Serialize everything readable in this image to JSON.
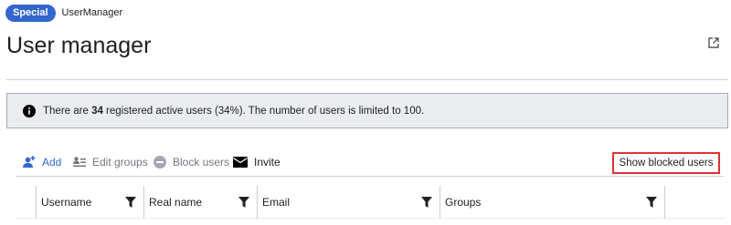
{
  "breadcrumb": {
    "badge": "Special",
    "page": "UserManager"
  },
  "page_title": "User manager",
  "notice": {
    "prefix": "There are ",
    "count": "34",
    "suffix": " registered active users (34%). The number of users is limited to 100."
  },
  "toolbar": {
    "add": "Add",
    "edit_groups": "Edit groups",
    "block_users": "Block users",
    "invite": "Invite",
    "show_blocked": "Show blocked users"
  },
  "table": {
    "columns": [
      "Username",
      "Real name",
      "Email",
      "Groups"
    ]
  },
  "colors": {
    "accent": "#3366cc",
    "highlight_border": "#dd3333",
    "notice_bg": "#eaecf0"
  },
  "icons": [
    "popout-icon",
    "info-icon",
    "add-user-icon",
    "edit-groups-icon",
    "block-icon",
    "mail-icon",
    "filter-icon"
  ]
}
